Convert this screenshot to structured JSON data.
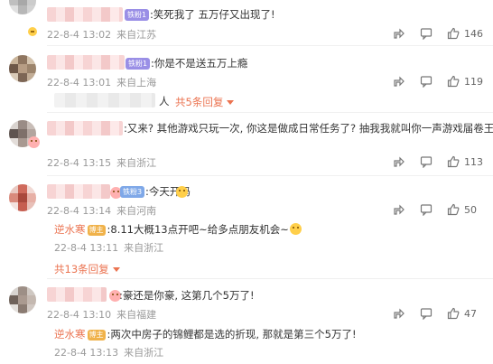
{
  "comments": [
    {
      "text": ":笑死我了 五万仔又出现了!",
      "badge": "铁粉1",
      "time": "22-8-4 13:02",
      "location": "来自江苏",
      "likes": "146"
    },
    {
      "text": ":你是不是送五万上瘾",
      "badge": "铁粉1",
      "time": "22-8-4 13:01",
      "location": "来自上海",
      "likes": "119",
      "reply_suffix": "人",
      "reply_link": "共5条回复"
    },
    {
      "text": ":又来? 其他游戏只玩一次, 你这是做成日常任务了? 抽我我就叫你一声游戏届卷王",
      "time": "22-8-4 13:15",
      "location": "来自浙江",
      "likes": "113"
    },
    {
      "text": ":今天开吗",
      "badge": "铁粉3",
      "time": "22-8-4 13:14",
      "location": "来自河南",
      "likes": "50",
      "reply": {
        "name": "逆水寒",
        "badge": "博主",
        "text": ":8.11大概13点开吧~给多点朋友机会~",
        "time": "22-8-4 13:11",
        "location": "来自浙江"
      },
      "reply_link": "共13条回复"
    },
    {
      "text": ":豪还是你豪, 这第几个5万了!",
      "time": "22-8-4 13:10",
      "location": "来自福建",
      "likes": "47",
      "reply": {
        "name": "逆水寒",
        "badge": "博主",
        "text": ":两次中房子的锦鲤都是选的折现, 那就是第三个5万了!",
        "time": "22-8-4 13:13",
        "location": "来自浙江"
      }
    }
  ],
  "icons": {
    "share": "share-icon",
    "comment": "comment-icon",
    "like": "like-icon"
  },
  "colors": {
    "accent": "#eb7350",
    "meta": "#999999"
  }
}
